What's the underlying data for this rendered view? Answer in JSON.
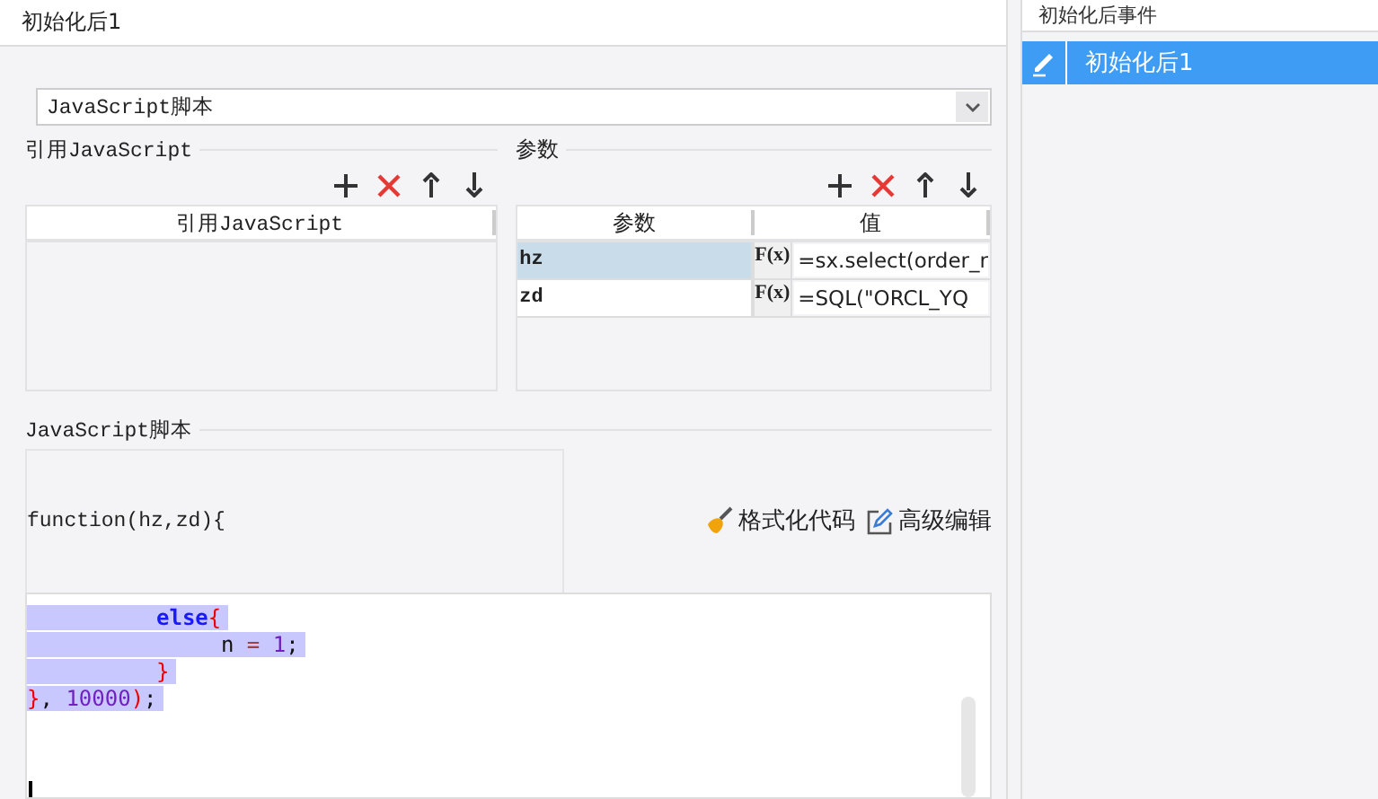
{
  "tab_title": "初始化后1",
  "script_type": {
    "value": "JavaScript脚本"
  },
  "ref_section": {
    "title": "引用JavaScript",
    "column": "引用JavaScript"
  },
  "params_section": {
    "title": "参数",
    "columns": [
      "参数",
      "值"
    ],
    "rows": [
      {
        "name": "hz",
        "formula": "F(x)",
        "value": "=sx.select(order_r",
        "selected": true
      },
      {
        "name": "zd",
        "formula": "F(x)",
        "value": "=SQL(\"ORCL_YQ",
        "selected": false
      }
    ]
  },
  "script_section": {
    "title": "JavaScript脚本",
    "signature": "function(hz,zd){",
    "format_button": "格式化代码",
    "advanced_button": "高级编辑",
    "lines": [
      {
        "children": [
          {
            "selected": true,
            "tokens": [
              {
                "kind": "keyword",
                "text": "else"
              },
              {
                "kind": "brace",
                "text": "{"
              }
            ],
            "children": [
              {
                "selected": true,
                "tokens": [
                  {
                    "kind": "plain",
                    "text": "n"
                  },
                  {
                    "kind": "op",
                    "text": "="
                  },
                  {
                    "kind": "number",
                    "text": "1"
                  },
                  {
                    "kind": "plain",
                    "text": ";"
                  }
                ]
              }
            ]
          },
          {
            "selected": true,
            "tokens": [
              {
                "kind": "brace",
                "text": "}"
              }
            ]
          }
        ]
      },
      {
        "selected": true,
        "tokens": [
          {
            "kind": "brace",
            "text": "}"
          },
          {
            "kind": "plain",
            "text": ", "
          },
          {
            "kind": "number",
            "text": "10000"
          },
          {
            "kind": "brace",
            "text": ")"
          },
          {
            "kind": "plain",
            "text": ";"
          }
        ]
      }
    ]
  },
  "events_panel": {
    "title": "初始化后事件",
    "items": [
      {
        "label": "初始化后1",
        "selected": true
      }
    ]
  }
}
